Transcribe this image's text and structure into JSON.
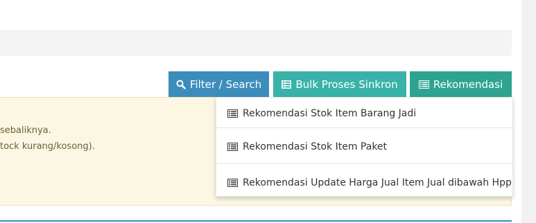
{
  "toolbar": {
    "filter_label": "Filter / Search",
    "bulk_label": "Bulk Proses Sinkron",
    "rekomendasi_label": "Rekomendasi"
  },
  "callout": {
    "line1": "sebaliknya.",
    "line2": "tock kurang/kosong)."
  },
  "dropdown": {
    "items": [
      {
        "label": "Rekomendasi Stok Item Barang Jadi",
        "icon": "list-icon"
      },
      {
        "label": "Rekomendasi Stok Item Paket",
        "icon": "list-icon"
      },
      {
        "label": "Rekomendasi Update Harga Jual Item Jual dibawah Hpp",
        "icon": "list-icon"
      }
    ]
  },
  "colors": {
    "filter_button": "#3c8dbc",
    "bulk_button": "#39b3a9",
    "rekomendasi_button": "#2fa392",
    "callout_bg": "#fcf7e3"
  }
}
